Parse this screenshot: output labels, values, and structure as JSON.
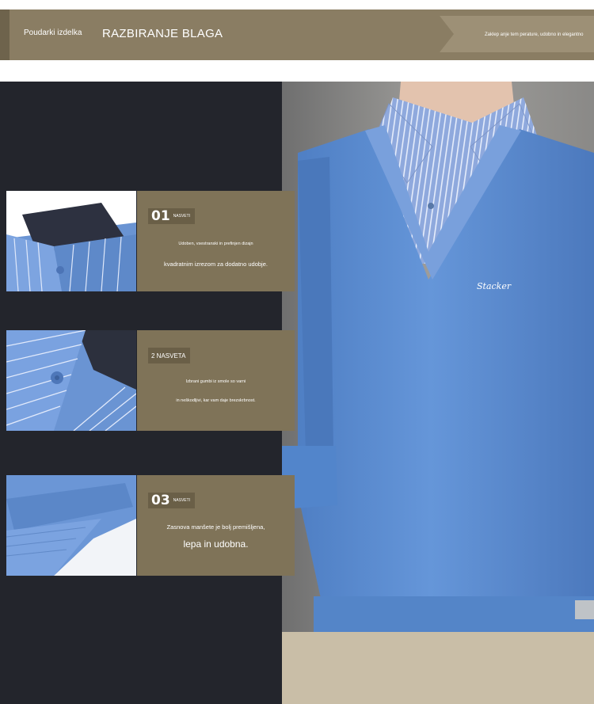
{
  "header": {
    "tag": "Poudarki izdelka",
    "title": "RAZBIRANJE BLAGA",
    "note": "Zaklep anje tem perature, udobno in elegantno"
  },
  "tips": [
    {
      "number": "01",
      "badge": "NASVETI",
      "lines": [
        "Udoben, vsestranski in prefinjen dizajn",
        "kvadratnim izrezom za dodatno udobje."
      ]
    },
    {
      "number": "",
      "badge": "2 NASVETA",
      "lines": [
        "Izbrani gumbi iz smole so varni",
        "in neškodljivi, kar vam daje brezskrbnost."
      ]
    },
    {
      "number": "03",
      "badge": "NASVETI",
      "lines": [
        "Zasnova manšete je bolj premišljena,",
        "lepa in udobna."
      ]
    }
  ],
  "logo_script": "Stacker",
  "colors": {
    "header_bg": "#8a7d63",
    "panel_bg": "#7f7358",
    "stage_bg": "#23252c",
    "sweater_blue": "#5f8fd3",
    "shirt_stripe": "#a8bfe9"
  }
}
